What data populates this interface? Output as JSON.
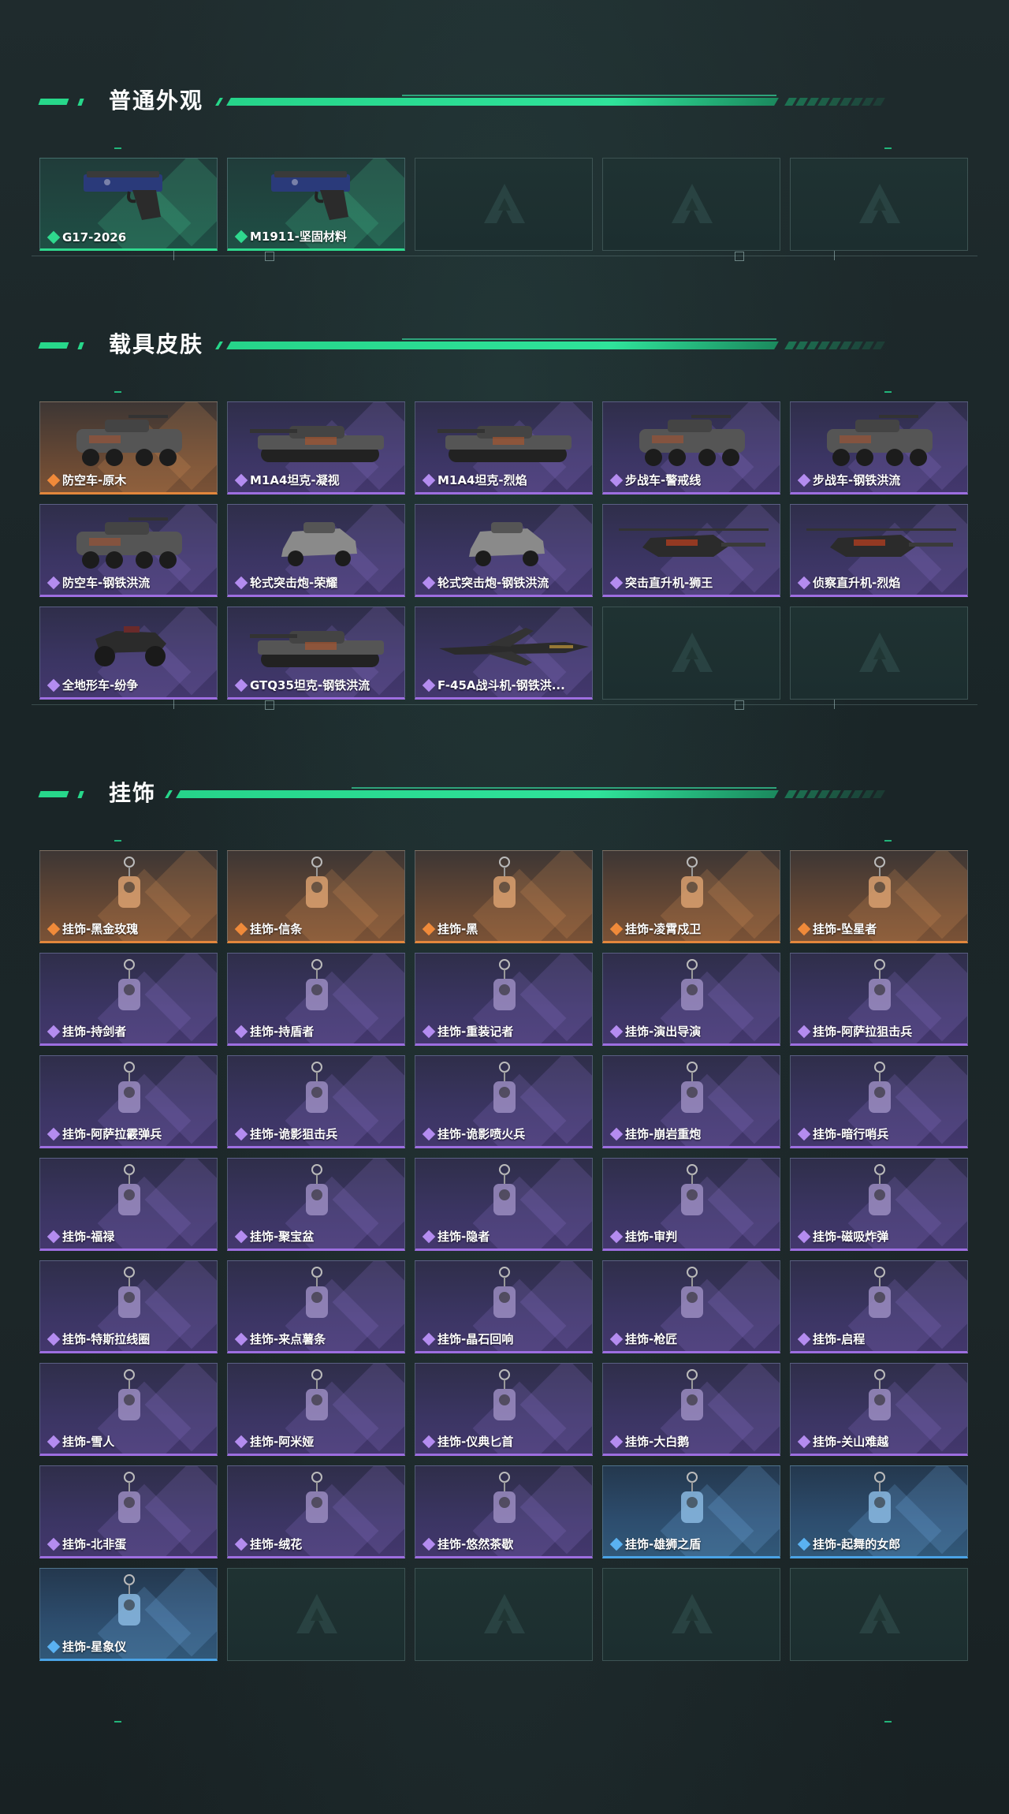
{
  "sections": [
    {
      "title": "普通外观",
      "items": [
        {
          "label": "G17-2026",
          "rarity": "green",
          "icon": "pistol-icon"
        },
        {
          "label": "M1911-坚固材料",
          "rarity": "green",
          "icon": "pistol-icon"
        },
        {
          "label": "",
          "rarity": "empty"
        },
        {
          "label": "",
          "rarity": "empty"
        },
        {
          "label": "",
          "rarity": "empty"
        }
      ]
    },
    {
      "title": "载具皮肤",
      "items": [
        {
          "label": "防空车-原木",
          "rarity": "orange",
          "icon": "apc-icon"
        },
        {
          "label": "M1A4坦克-凝视",
          "rarity": "purple",
          "icon": "tank-icon"
        },
        {
          "label": "M1A4坦克-烈焰",
          "rarity": "purple",
          "icon": "tank-icon"
        },
        {
          "label": "步战车-警戒线",
          "rarity": "purple",
          "icon": "apc-icon"
        },
        {
          "label": "步战车-钢铁洪流",
          "rarity": "purple",
          "icon": "apc-icon"
        },
        {
          "label": "防空车-钢铁洪流",
          "rarity": "purple",
          "icon": "apc-icon"
        },
        {
          "label": "轮式突击炮-荣耀",
          "rarity": "purple",
          "icon": "armored-car-icon"
        },
        {
          "label": "轮式突击炮-钢铁洪流",
          "rarity": "purple",
          "icon": "armored-car-icon"
        },
        {
          "label": "突击直升机-狮王",
          "rarity": "purple",
          "icon": "helicopter-icon"
        },
        {
          "label": "侦察直升机-烈焰",
          "rarity": "purple",
          "icon": "helicopter-icon"
        },
        {
          "label": "全地形车-纷争",
          "rarity": "purple",
          "icon": "atv-icon"
        },
        {
          "label": "GTQ35坦克-钢铁洪流",
          "rarity": "purple",
          "icon": "tank-icon"
        },
        {
          "label": "F-45A战斗机-钢铁洪...",
          "rarity": "purple",
          "icon": "jet-icon"
        },
        {
          "label": "",
          "rarity": "empty"
        },
        {
          "label": "",
          "rarity": "empty"
        }
      ]
    },
    {
      "title": "挂饰",
      "items": [
        {
          "label": "挂饰-黑金玫瑰",
          "rarity": "orange",
          "icon": "charm-icon"
        },
        {
          "label": "挂饰-信条",
          "rarity": "orange",
          "icon": "charm-icon"
        },
        {
          "label": "挂饰-黑",
          "rarity": "orange",
          "icon": "charm-icon"
        },
        {
          "label": "挂饰-凌霄戍卫",
          "rarity": "orange",
          "icon": "charm-icon"
        },
        {
          "label": "挂饰-坠星者",
          "rarity": "orange",
          "icon": "charm-icon"
        },
        {
          "label": "挂饰-持剑者",
          "rarity": "purple",
          "icon": "charm-icon"
        },
        {
          "label": "挂饰-持盾者",
          "rarity": "purple",
          "icon": "charm-icon"
        },
        {
          "label": "挂饰-重装记者",
          "rarity": "purple",
          "icon": "charm-icon"
        },
        {
          "label": "挂饰-演出导演",
          "rarity": "purple",
          "icon": "charm-icon"
        },
        {
          "label": "挂饰-阿萨拉狙击兵",
          "rarity": "purple",
          "icon": "charm-icon"
        },
        {
          "label": "挂饰-阿萨拉霰弹兵",
          "rarity": "purple",
          "icon": "charm-icon"
        },
        {
          "label": "挂饰-诡影狙击兵",
          "rarity": "purple",
          "icon": "charm-icon"
        },
        {
          "label": "挂饰-诡影喷火兵",
          "rarity": "purple",
          "icon": "charm-icon"
        },
        {
          "label": "挂饰-崩岩重炮",
          "rarity": "purple",
          "icon": "charm-icon"
        },
        {
          "label": "挂饰-暗行哨兵",
          "rarity": "purple",
          "icon": "charm-icon"
        },
        {
          "label": "挂饰-福禄",
          "rarity": "purple",
          "icon": "charm-icon"
        },
        {
          "label": "挂饰-聚宝盆",
          "rarity": "purple",
          "icon": "charm-icon"
        },
        {
          "label": "挂饰-隐者",
          "rarity": "purple",
          "icon": "charm-icon"
        },
        {
          "label": "挂饰-审判",
          "rarity": "purple",
          "icon": "charm-icon"
        },
        {
          "label": "挂饰-磁吸炸弹",
          "rarity": "purple",
          "icon": "charm-icon"
        },
        {
          "label": "挂饰-特斯拉线圈",
          "rarity": "purple",
          "icon": "charm-icon"
        },
        {
          "label": "挂饰-来点薯条",
          "rarity": "purple",
          "icon": "charm-icon"
        },
        {
          "label": "挂饰-晶石回响",
          "rarity": "purple",
          "icon": "charm-icon"
        },
        {
          "label": "挂饰-枪匠",
          "rarity": "purple",
          "icon": "charm-icon"
        },
        {
          "label": "挂饰-启程",
          "rarity": "purple",
          "icon": "charm-icon"
        },
        {
          "label": "挂饰-雪人",
          "rarity": "purple",
          "icon": "charm-icon"
        },
        {
          "label": "挂饰-阿米娅",
          "rarity": "purple",
          "icon": "charm-icon"
        },
        {
          "label": "挂饰-仪典匕首",
          "rarity": "purple",
          "icon": "charm-icon"
        },
        {
          "label": "挂饰-大白鹅",
          "rarity": "purple",
          "icon": "charm-icon"
        },
        {
          "label": "挂饰-关山难越",
          "rarity": "purple",
          "icon": "charm-icon"
        },
        {
          "label": "挂饰-北非蛋",
          "rarity": "purple",
          "icon": "charm-icon"
        },
        {
          "label": "挂饰-绒花",
          "rarity": "purple",
          "icon": "charm-icon"
        },
        {
          "label": "挂饰-悠然茶歇",
          "rarity": "purple",
          "icon": "charm-icon"
        },
        {
          "label": "挂饰-雄狮之盾",
          "rarity": "blue",
          "icon": "charm-icon"
        },
        {
          "label": "挂饰-起舞的女郎",
          "rarity": "blue",
          "icon": "charm-icon"
        },
        {
          "label": "挂饰-星象仪",
          "rarity": "blue",
          "icon": "charm-icon"
        },
        {
          "label": "",
          "rarity": "empty"
        },
        {
          "label": "",
          "rarity": "empty"
        },
        {
          "label": "",
          "rarity": "empty"
        },
        {
          "label": "",
          "rarity": "empty"
        }
      ]
    }
  ],
  "colors": {
    "accent": "#27d78a",
    "rarity_green": "#2fd98e",
    "rarity_orange": "#e3873c",
    "rarity_purple": "#9d6ee0",
    "rarity_blue": "#4aa3e6"
  }
}
